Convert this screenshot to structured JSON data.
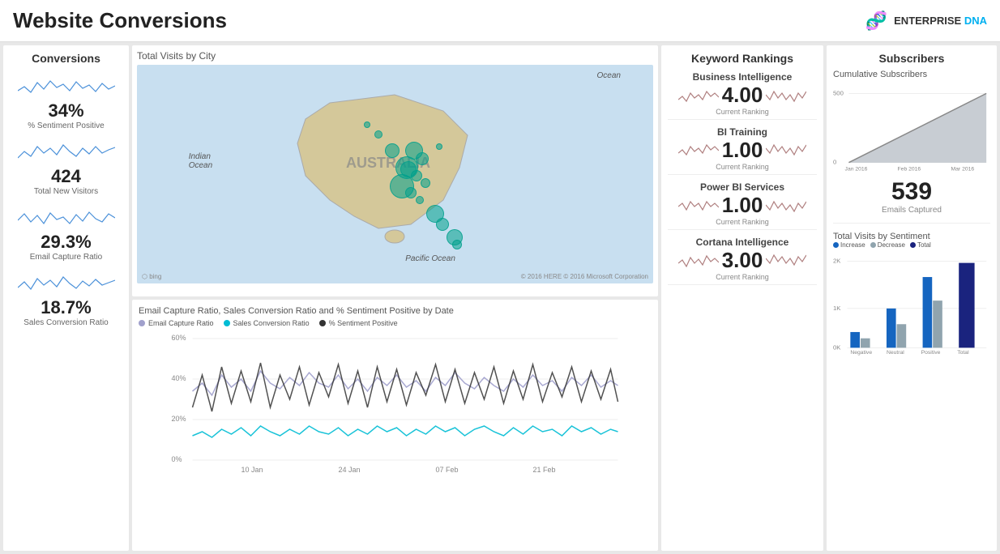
{
  "header": {
    "title": "Website Conversions",
    "logo_text": "ENTERPRISE DNA",
    "logo_icon": "🧬"
  },
  "left_panel": {
    "title": "Conversions",
    "metrics": [
      {
        "value": "34%",
        "label": "% Sentiment Positive"
      },
      {
        "value": "424",
        "label": "Total New Visitors"
      },
      {
        "value": "29.3%",
        "label": "Email Capture Ratio"
      },
      {
        "value": "18.7%",
        "label": "Sales Conversion Ratio"
      }
    ]
  },
  "map_panel": {
    "title": "Total Visits by City",
    "labels": [
      "Indian Ocean",
      "Ocean",
      "Pacific Ocean",
      "AUSTRALIA"
    ],
    "footer": "© 2016 HERE  © 2016 Microsoft Corporation",
    "bing": "bing"
  },
  "chart_panel": {
    "title": "Email Capture Ratio, Sales Conversion Ratio and % Sentiment Positive by Date",
    "legend": [
      {
        "label": "Email Capture Ratio",
        "color": "#a0a0cc"
      },
      {
        "label": "Sales Conversion Ratio",
        "color": "#00bcd4"
      },
      {
        "label": "% Sentiment Positive",
        "color": "#333"
      }
    ],
    "x_labels": [
      "10 Jan",
      "24 Jan",
      "07 Feb",
      "21 Feb"
    ],
    "y_labels": [
      "60%",
      "40%",
      "20%",
      "0%"
    ]
  },
  "keyword_panel": {
    "title": "Keyword Rankings",
    "keywords": [
      {
        "name": "Business Intelligence",
        "rank": "4.00",
        "label": "Current Ranking"
      },
      {
        "name": "BI Training",
        "rank": "1.00",
        "label": "Current Ranking"
      },
      {
        "name": "Power BI Services",
        "rank": "1.00",
        "label": "Current Ranking"
      },
      {
        "name": "Cortana Intelligence",
        "rank": "3.00",
        "label": "Current Ranking"
      }
    ]
  },
  "subscribers_panel": {
    "title": "Subscribers",
    "cumulative_label": "Cumulative Subscribers",
    "y_labels": [
      "500",
      "0"
    ],
    "x_labels": [
      "Jan 2016",
      "Feb 2016",
      "Mar 2016"
    ],
    "emails_value": "539",
    "emails_label": "Emails Captured",
    "visits_title": "Total Visits by Sentiment",
    "bar_legend": [
      {
        "label": "Increase",
        "color": "#1565c0"
      },
      {
        "label": "Decrease",
        "color": "#90a4ae"
      },
      {
        "label": "Total",
        "color": "#1a237e"
      }
    ],
    "bar_y_labels": [
      "2K",
      "1K",
      "0K"
    ],
    "bar_x_labels": [
      "Negative",
      "Neutral",
      "Positive",
      "Total"
    ]
  }
}
